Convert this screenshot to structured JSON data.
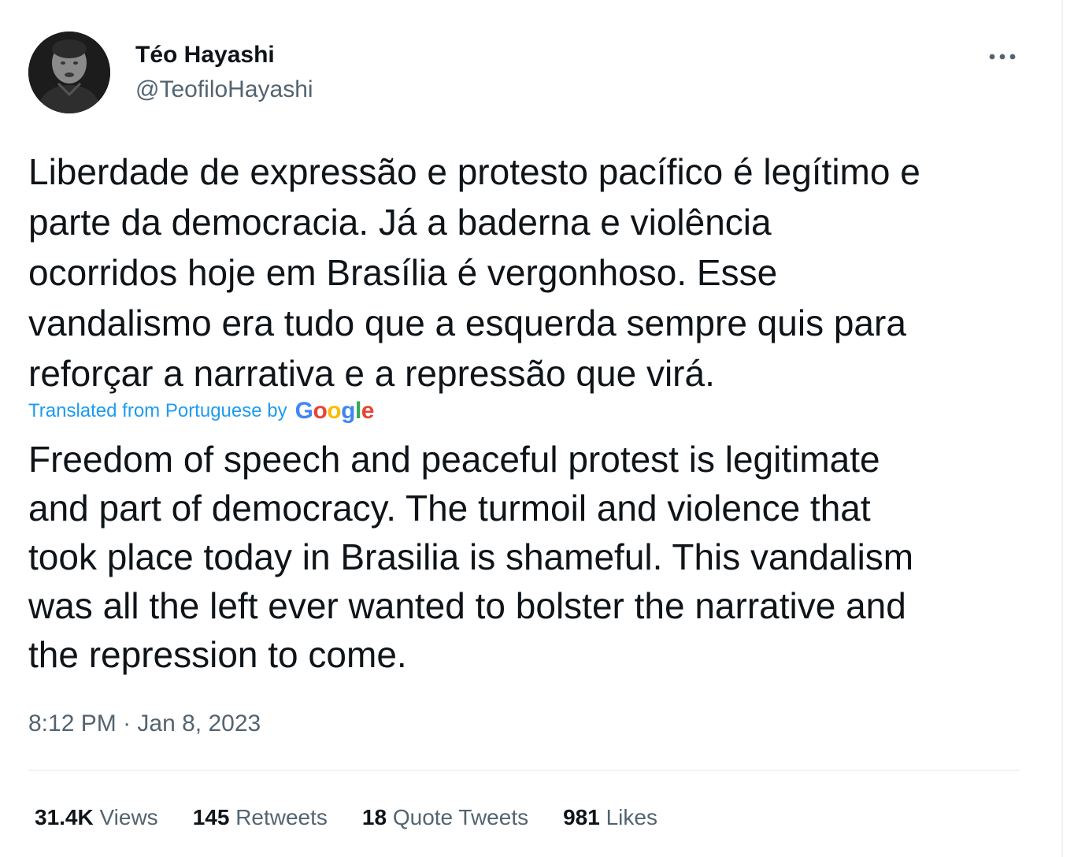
{
  "author": {
    "display_name": "Téo Hayashi",
    "handle": "@TeofiloHayashi",
    "avatar_icon": "profile-photo"
  },
  "menu": {
    "icon": "more-horizontal-icon"
  },
  "tweet": {
    "original_text": "Liberdade de expressão e protesto pacífico é legítimo e\nparte da democracia. Já a baderna e violência\nocorridos hoje em Brasília é vergonhoso. Esse\nvandalismo era tudo que a esquerda sempre quis para\nreforçar a narrativa e a repressão que virá.",
    "translation_label": "Translated from Portuguese by",
    "translation_provider": "Google",
    "translated_text": "Freedom of speech and peaceful protest is legitimate\nand part of democracy. The turmoil and violence that\ntook place today in Brasilia is shameful. This vandalism\nwas all the left ever wanted to bolster the narrative and\nthe repression to come.",
    "time": "8:12 PM",
    "separator": " · ",
    "date": "Jan 8, 2023"
  },
  "stats": {
    "views_count": "31.4K",
    "views_label": "Views",
    "retweets_count": "145",
    "retweets_label": "Retweets",
    "quotes_count": "18",
    "quotes_label": "Quote Tweets",
    "likes_count": "981",
    "likes_label": "Likes"
  },
  "colors": {
    "text_primary": "#0f1419",
    "text_secondary": "#536471",
    "link_blue": "#1d9bf0",
    "divider": "#eff3f4",
    "google_blue": "#4285f4",
    "google_red": "#ea4335",
    "google_yellow": "#fbbc05",
    "google_green": "#34a853"
  }
}
